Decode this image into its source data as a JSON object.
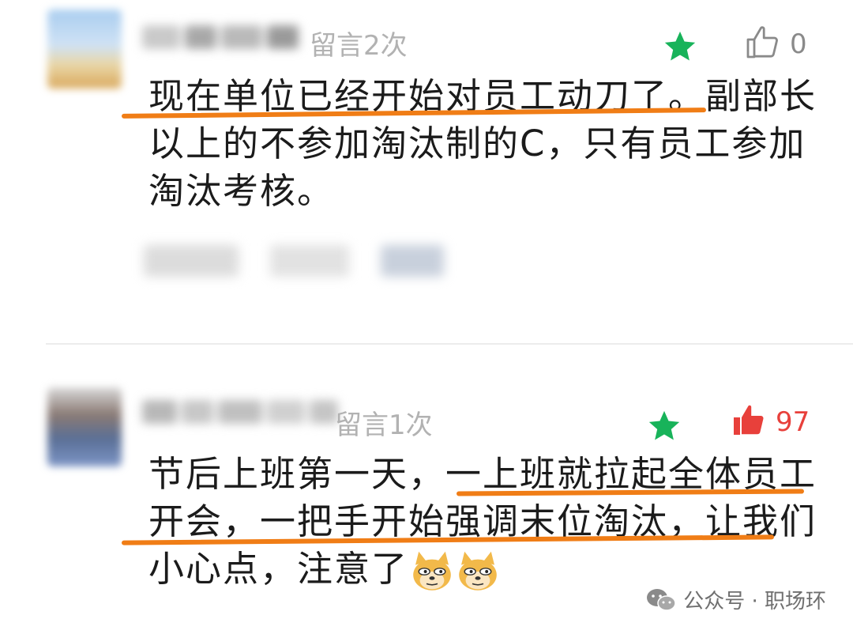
{
  "comments": [
    {
      "visit_count": "留言2次",
      "like_count": "0",
      "liked": false,
      "text": "现在单位已经开始对员工动刀了。副部长以上的不参加淘汰制的C，只有员工参加淘汰考核。"
    },
    {
      "visit_count": "留言1次",
      "like_count": "97",
      "liked": true,
      "text": "节后上班第一天，一上班就拉起全体员工开会，一把手开始强调末位淘汰，让我们小心点，注意了"
    }
  ],
  "watermark": {
    "label": "公众号 · 职场环"
  },
  "icons": {
    "star": "star-icon",
    "like": "thumbs-up-icon",
    "emoji": "doge-emoji-icon",
    "wechat": "wechat-icon"
  },
  "colors": {
    "star": "#18b35a",
    "like_active": "#e8403b",
    "like_inactive": "#8a8a8a",
    "underline": "#f07d16",
    "meta_text": "#b2b2b2"
  }
}
